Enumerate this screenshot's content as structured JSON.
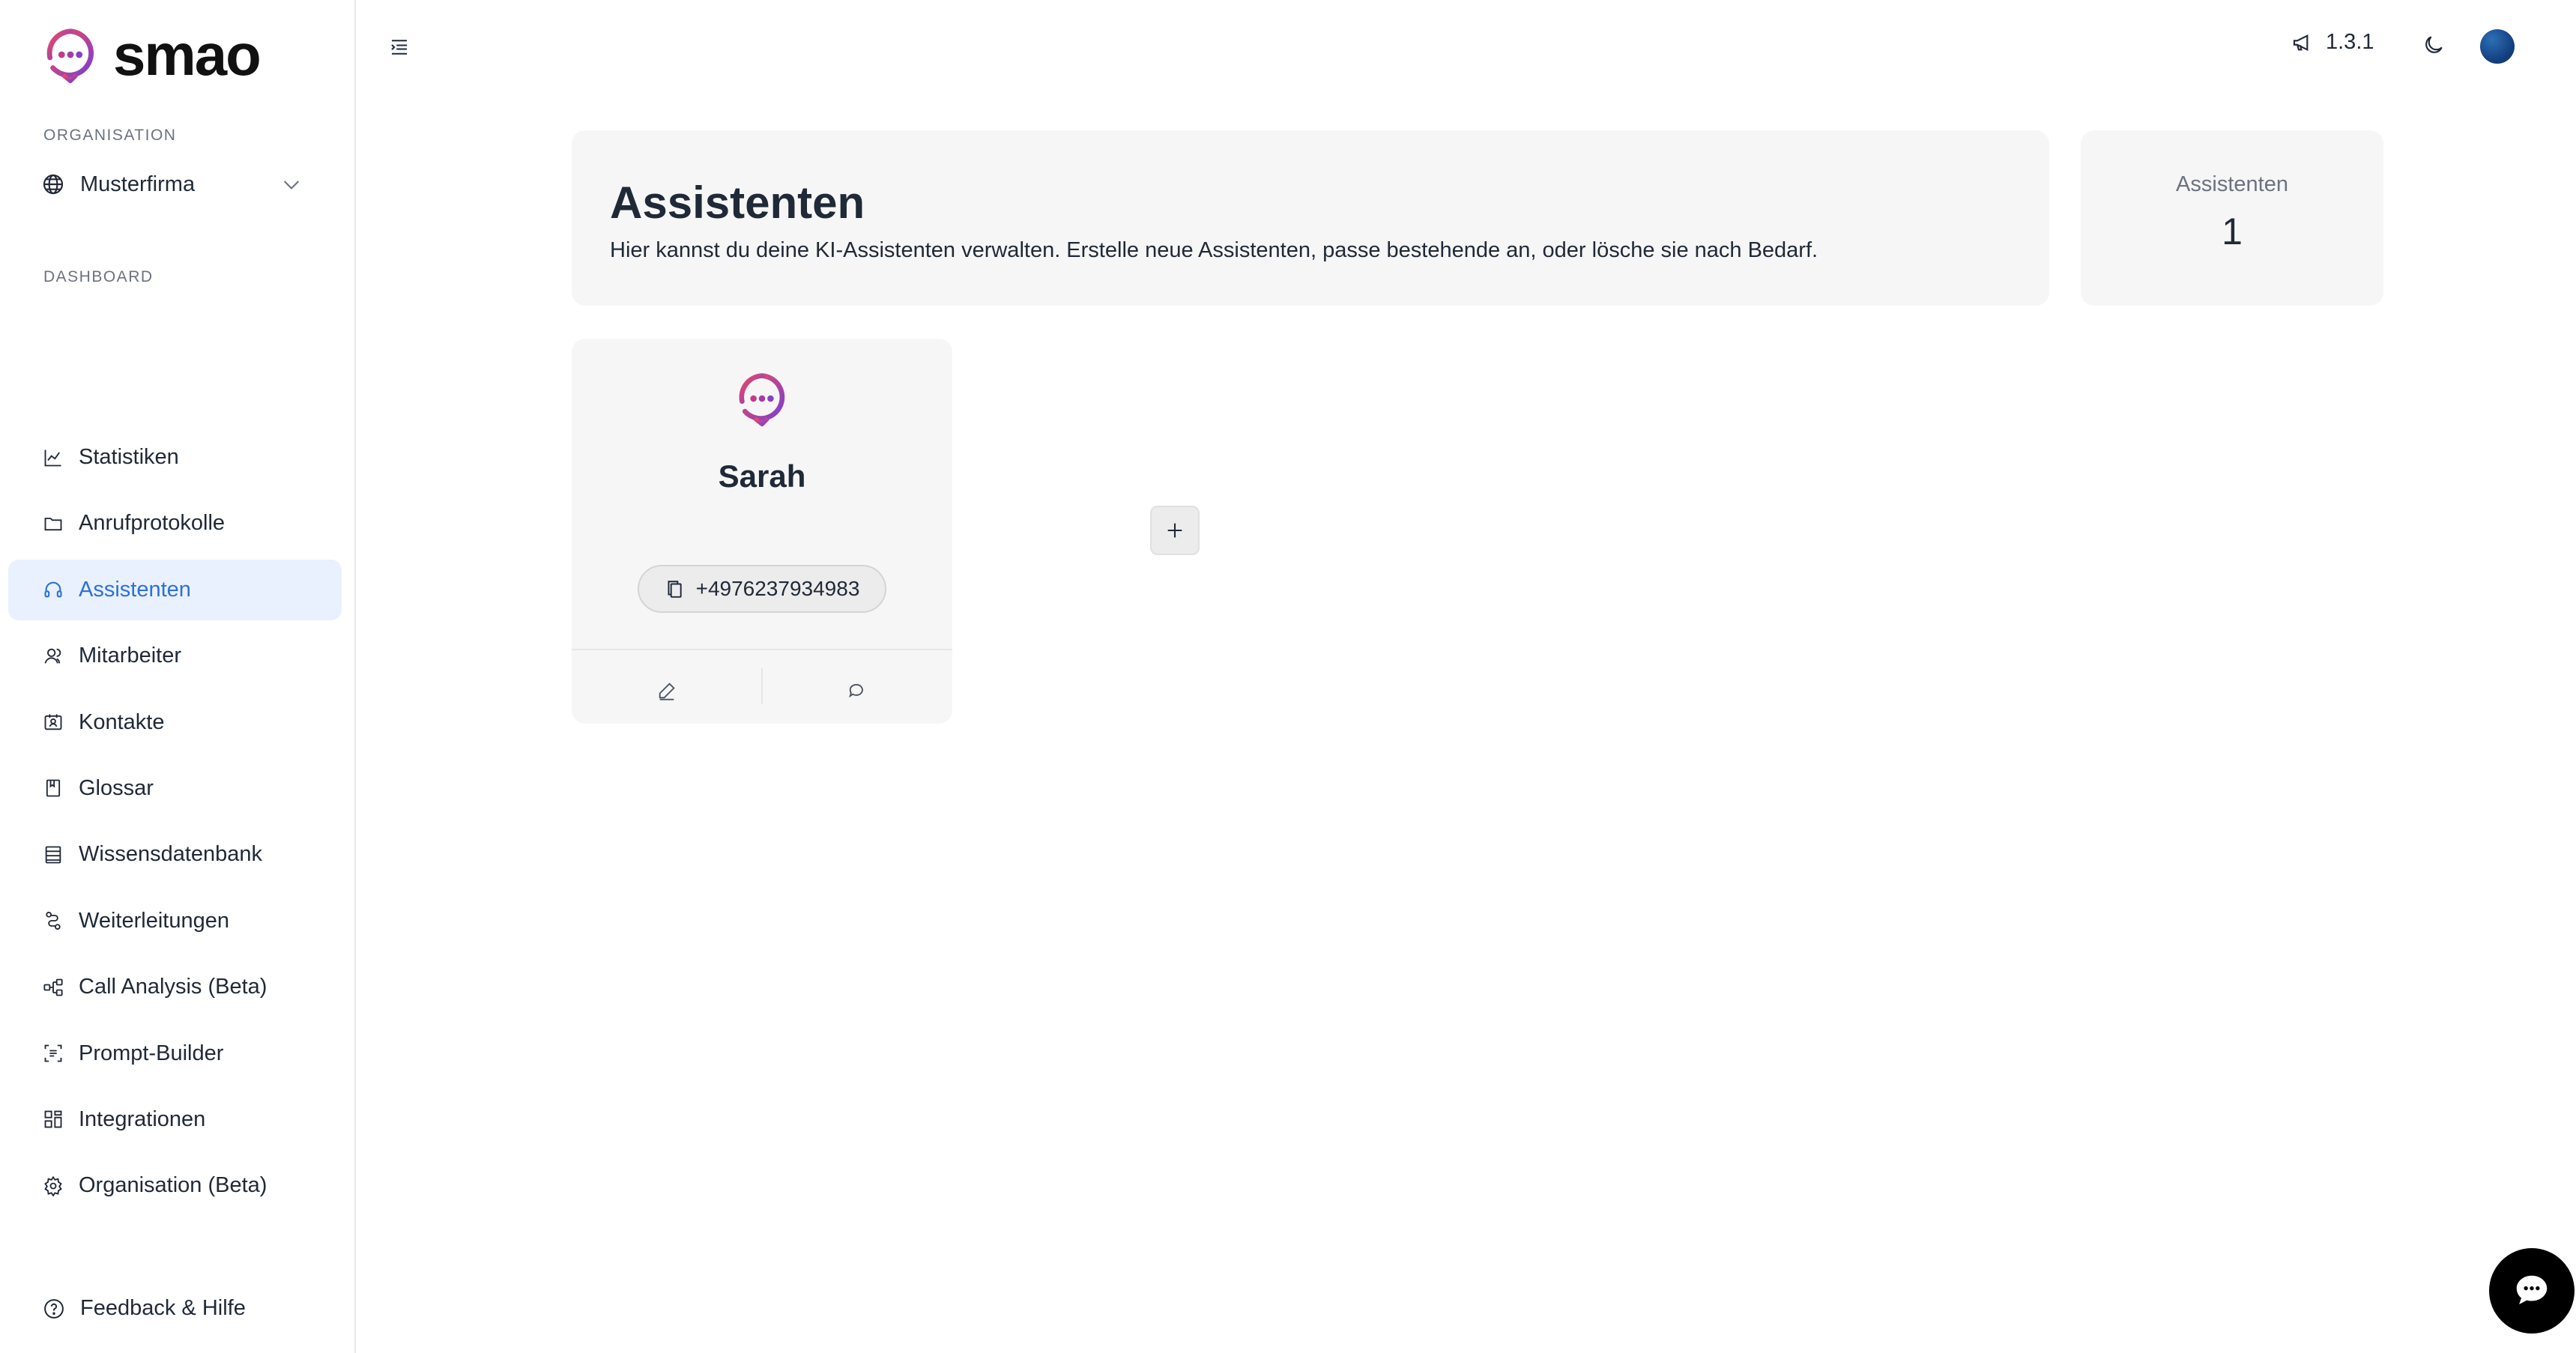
{
  "app": {
    "brand": "smao",
    "version": "1.3.1",
    "brand_colors": [
      "#e8345a",
      "#7b3fd0"
    ],
    "accent": "#2f6fd6"
  },
  "sidebar": {
    "organisation_label": "ORGANISATION",
    "organisation_name": "Musterfirma",
    "dashboard_label": "DASHBOARD",
    "items": [
      {
        "label": "Statistiken",
        "icon": "chart-line-icon"
      },
      {
        "label": "Anrufprotokolle",
        "icon": "folder-icon"
      },
      {
        "label": "Assistenten",
        "icon": "headset-icon",
        "active": true
      },
      {
        "label": "Mitarbeiter",
        "icon": "users-icon"
      },
      {
        "label": "Kontakte",
        "icon": "contact-card-icon"
      },
      {
        "label": "Glossar",
        "icon": "book-icon"
      },
      {
        "label": "Wissensdatenbank",
        "icon": "database-icon"
      },
      {
        "label": "Weiterleitungen",
        "icon": "route-icon"
      },
      {
        "label": "Call Analysis (Beta)",
        "icon": "flow-icon"
      },
      {
        "label": "Prompt-Builder",
        "icon": "scan-text-icon"
      },
      {
        "label": "Integrationen",
        "icon": "widgets-icon"
      },
      {
        "label": "Organisation (Beta)",
        "icon": "gear-icon"
      }
    ],
    "feedback_label": "Feedback & Hilfe"
  },
  "header": {
    "title": "Assistenten",
    "description": "Hier kannst du deine KI-Assistenten verwalten. Erstelle neue Assistenten, passe bestehende an, oder lösche sie nach Bedarf."
  },
  "stats": {
    "label": "Assistenten",
    "value": "1"
  },
  "assistants": [
    {
      "name": "Sarah",
      "phone": "+4976237934983"
    }
  ]
}
